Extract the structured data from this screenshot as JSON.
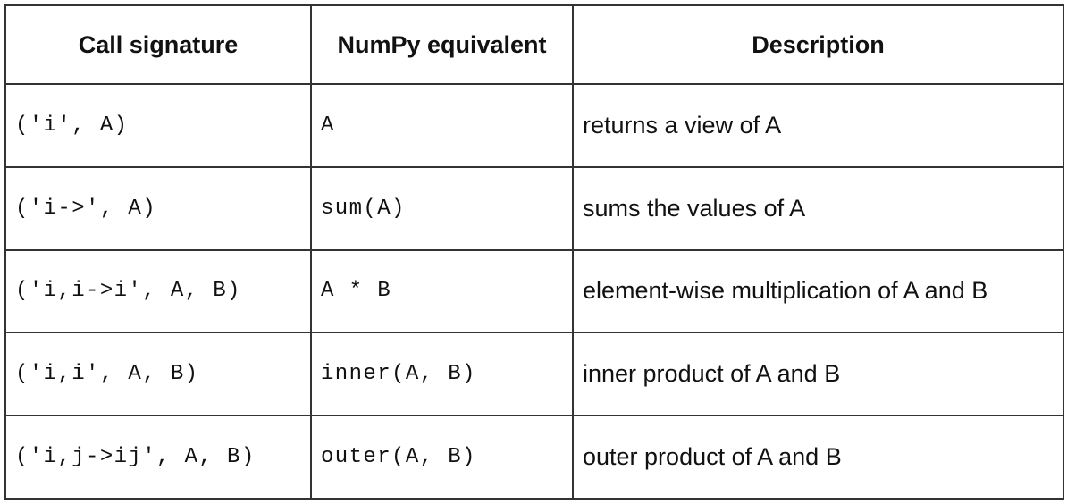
{
  "table": {
    "headers": [
      "Call signature",
      "NumPy equivalent",
      "Description"
    ],
    "rows": [
      {
        "signature": "('i', A)",
        "equivalent": "A",
        "description": "returns a view of A"
      },
      {
        "signature": "('i->', A)",
        "equivalent": "sum(A)",
        "description": "sums the values of A"
      },
      {
        "signature": "('i,i->i', A, B)",
        "equivalent": "A * B",
        "description": "element-wise multiplication of A and B"
      },
      {
        "signature": "('i,i', A, B)",
        "equivalent": "inner(A, B)",
        "description": "inner product of A and B"
      },
      {
        "signature": "('i,j->ij', A, B)",
        "equivalent": "outer(A, B)",
        "description": "outer product of A and B"
      }
    ]
  }
}
